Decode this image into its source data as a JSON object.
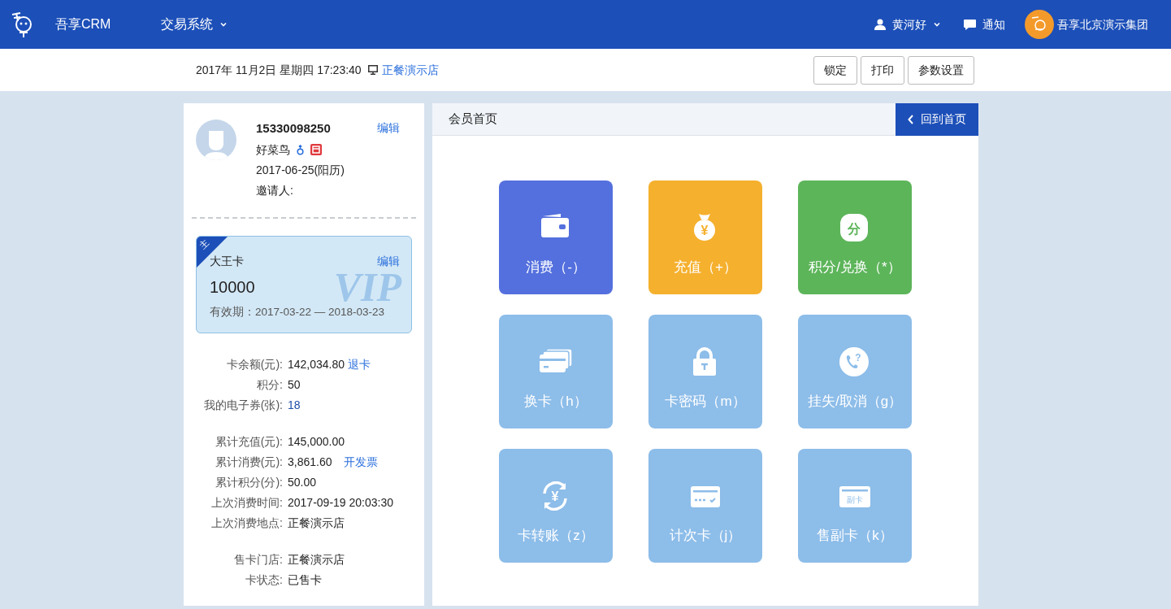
{
  "navbar": {
    "brand": "吾享CRM",
    "menu": "交易系统",
    "user": "黄河好",
    "notice": "通知",
    "org": "吾享北京演示集团"
  },
  "subbar": {
    "datetime": "2017年 11月2日  星期四  17:23:40",
    "store": "正餐演示店",
    "buttons": [
      "锁定",
      "打印",
      "参数设置"
    ]
  },
  "member": {
    "phone": "15330098250",
    "edit": "编辑",
    "name": "好菜鸟",
    "birthday": "2017-06-25(阳历)",
    "inviter": "邀请人:"
  },
  "card": {
    "badge": "主",
    "name": "大王卡",
    "edit": "编辑",
    "number": "10000",
    "watermark": "VIP",
    "validity": "有效期：2017-03-22 — 2018-03-23"
  },
  "info_groups": [
    [
      {
        "label": "卡余额(元):",
        "value": "142,034.80",
        "link": "退卡"
      },
      {
        "label": "积分:",
        "value": "50"
      },
      {
        "label": "我的电子券(张):",
        "value": "18",
        "kind": "link"
      }
    ],
    [
      {
        "label": "累计充值(元):",
        "value": "145,000.00"
      },
      {
        "label": "累计消费(元):",
        "value": "3,861.60",
        "link": "开发票"
      },
      {
        "label": "累计积分(分):",
        "value": "50.00"
      },
      {
        "label": "上次消费时间:",
        "value": "2017-09-19 20:03:30"
      },
      {
        "label": "上次消费地点:",
        "value": "正餐演示店"
      }
    ],
    [
      {
        "label": "售卡门店:",
        "value": "正餐演示店"
      },
      {
        "label": "卡状态:",
        "value": "已售卡"
      }
    ]
  ],
  "panel": {
    "title": "会员首页",
    "back": "回到首页"
  },
  "tiles": [
    {
      "kind": "wallet",
      "label": "消费（-）",
      "color": "#5470de"
    },
    {
      "kind": "moneybag",
      "label": "充值（+）",
      "icon_text": "¥",
      "color": "#f5b02e"
    },
    {
      "kind": "points",
      "label": "积分/兑换（*）",
      "icon_text": "分",
      "color": "#5db55a"
    },
    {
      "kind": "cards",
      "label": "换卡（h）",
      "color": "#8dbde9"
    },
    {
      "kind": "lock",
      "label": "卡密码（m）",
      "color": "#8dbde9"
    },
    {
      "kind": "phone",
      "label": "挂失/取消（g）",
      "icon_text": "?",
      "color": "#8dbde9"
    },
    {
      "kind": "transfer",
      "label": "卡转账（z）",
      "icon_text": "¥",
      "color": "#8dbde9"
    },
    {
      "kind": "countcard",
      "label": "计次卡（j）",
      "color": "#8dbde9"
    },
    {
      "kind": "subcard",
      "label": "售副卡（k）",
      "icon_text": "副卡",
      "color": "#8dbde9"
    }
  ]
}
